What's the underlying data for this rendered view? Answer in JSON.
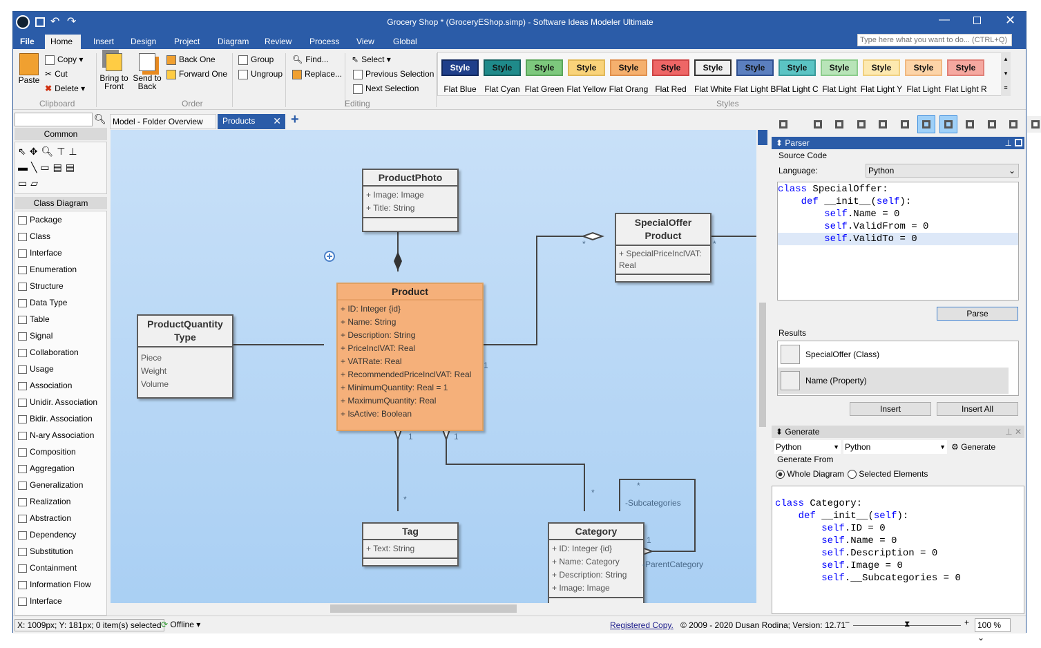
{
  "window": {
    "title": "Grocery Shop * (GroceryEShop.simp) - Software Ideas Modeler Ultimate",
    "search_placeholder": "Type here what you want to do... (CTRL+Q)"
  },
  "ribbon_tabs": [
    "File",
    "Home",
    "Insert",
    "Design",
    "Project",
    "Diagram",
    "Review",
    "Process",
    "View",
    "Global"
  ],
  "ribbon": {
    "clipboard": {
      "paste": "Paste",
      "copy": "Copy",
      "cut": "Cut",
      "delete": "Delete",
      "label": "Clipboard"
    },
    "order": {
      "bring_front": "Bring to Front",
      "send_back": "Send to Back",
      "back_one": "Back One",
      "forward_one": "Forward One",
      "group": "Group",
      "ungroup": "Ungroup",
      "label": "Order"
    },
    "editing": {
      "find": "Find...",
      "replace": "Replace...",
      "select": "Select",
      "prev_sel": "Previous Selection",
      "next_sel": "Next Selection",
      "label": "Editing"
    },
    "styles": {
      "label": "Styles",
      "button_text": "Style",
      "items": [
        {
          "name": "Flat Blue",
          "bg": "#1f3f8a",
          "border": "#12295e",
          "fg": "#ffffff"
        },
        {
          "name": "Flat Cyan",
          "bg": "#1f8a8a",
          "border": "#146060",
          "fg": "#111111"
        },
        {
          "name": "Flat Green",
          "bg": "#7dc87d",
          "border": "#5aa55a",
          "fg": "#111111"
        },
        {
          "name": "Flat Yellow",
          "bg": "#f9d37a",
          "border": "#e0b858",
          "fg": "#111111"
        },
        {
          "name": "Flat Orang",
          "bg": "#f5b06e",
          "border": "#e0904e",
          "fg": "#111111"
        },
        {
          "name": "Flat Red",
          "bg": "#ee6666",
          "border": "#cc4444",
          "fg": "#111111"
        },
        {
          "name": "Flat White",
          "bg": "#f0f0f0",
          "border": "#333333",
          "fg": "#111111"
        },
        {
          "name": "Flat Light B",
          "bg": "#5b7fbf",
          "border": "#2e4f8f",
          "fg": "#111111"
        },
        {
          "name": "Flat Light C",
          "bg": "#5bc4c4",
          "border": "#3a9a9a",
          "fg": "#111111"
        },
        {
          "name": "Flat Light",
          "bg": "#b8e4b8",
          "border": "#8ccc8c",
          "fg": "#111111"
        },
        {
          "name": "Flat Light Y",
          "bg": "#fde9b0",
          "border": "#f0d080",
          "fg": "#111111"
        },
        {
          "name": "Flat Light",
          "bg": "#fcd4a8",
          "border": "#f0b880",
          "fg": "#111111"
        },
        {
          "name": "Flat Light R",
          "bg": "#f5a8a0",
          "border": "#e08078",
          "fg": "#111111"
        }
      ]
    }
  },
  "toolbox": {
    "common_label": "Common",
    "class_diagram_label": "Class Diagram",
    "items": [
      "Package",
      "Class",
      "Interface",
      "Enumeration",
      "Structure",
      "Data Type",
      "Table",
      "Signal",
      "Collaboration",
      "Usage",
      "Association",
      "Unidir. Association",
      "Bidir. Association",
      "N-ary Association",
      "Composition",
      "Aggregation",
      "Generalization",
      "Realization",
      "Abstraction",
      "Dependency",
      "Substitution",
      "Containment",
      "Information Flow",
      "Interface"
    ]
  },
  "doc_tabs": [
    {
      "label": "Model - Folder Overview",
      "active": false
    },
    {
      "label": "Products",
      "active": true
    }
  ],
  "diagram": {
    "classes": {
      "product_photo": {
        "name": "ProductPhoto",
        "attrs": [
          "+ Image: Image",
          "+ Title: String"
        ]
      },
      "special_offer": {
        "name": "SpecialOffer\nProduct",
        "attrs": [
          "+ SpecialPriceInclVAT:",
          "Real"
        ]
      },
      "product": {
        "name": "Product",
        "attrs": [
          "+ ID: Integer {id}",
          "+ Name: String",
          "+ Description: String",
          "+ PriceInclVAT: Real",
          "+ VATRate: Real",
          "+ RecommendedPriceInclVAT: Real",
          "+ MinimumQuantity: Real = 1",
          "+ MaximumQuantity: Real",
          "+ IsActive: Boolean"
        ]
      },
      "pqt": {
        "name": "ProductQuantity\nType",
        "attrs": [
          "Piece",
          "Weight",
          "Volume"
        ]
      },
      "tag": {
        "name": "Tag",
        "attrs": [
          "+ Text: String"
        ]
      },
      "category": {
        "name": "Category",
        "attrs": [
          "+ ID: Integer {id}",
          "+ Name: Category",
          "+ Description: String",
          "+ Image: Image"
        ]
      }
    },
    "labels": {
      "star": "*",
      "one": "1",
      "subcategories": "-Subcategories",
      "parent": "-ParentCategory"
    }
  },
  "parser": {
    "title": "Parser",
    "source_code": "Source Code",
    "language_label": "Language:",
    "language": "Python",
    "code": [
      "class SpecialOffer:",
      "    def __init__(self):",
      "        self.Name = 0",
      "        self.ValidFrom = 0",
      "        self.ValidTo = 0"
    ],
    "parse": "Parse",
    "results_label": "Results",
    "results": [
      "SpecialOffer (Class)",
      "Name (Property)"
    ],
    "insert": "Insert",
    "insert_all": "Insert All"
  },
  "generate": {
    "title": "Generate",
    "lang1": "Python",
    "lang2": "Python",
    "generate": "Generate",
    "from_label": "Generate From",
    "whole": "Whole Diagram",
    "selected": "Selected Elements",
    "whole_checked": true,
    "code": [
      "class Category:",
      "    def __init__(self):",
      "        self.ID = 0",
      "        self.Name = 0",
      "        self.Description = 0",
      "        self.Image = 0",
      "        self.__Subcategories = 0"
    ]
  },
  "status": {
    "coords": "X: 1009px; Y: 181px; 0 item(s) selected",
    "offline": "Offline",
    "registered": "Registered Copy.",
    "copyright": "© 2009 - 2020 Dusan Rodina; Version: 12.71",
    "zoom": "100 %"
  }
}
